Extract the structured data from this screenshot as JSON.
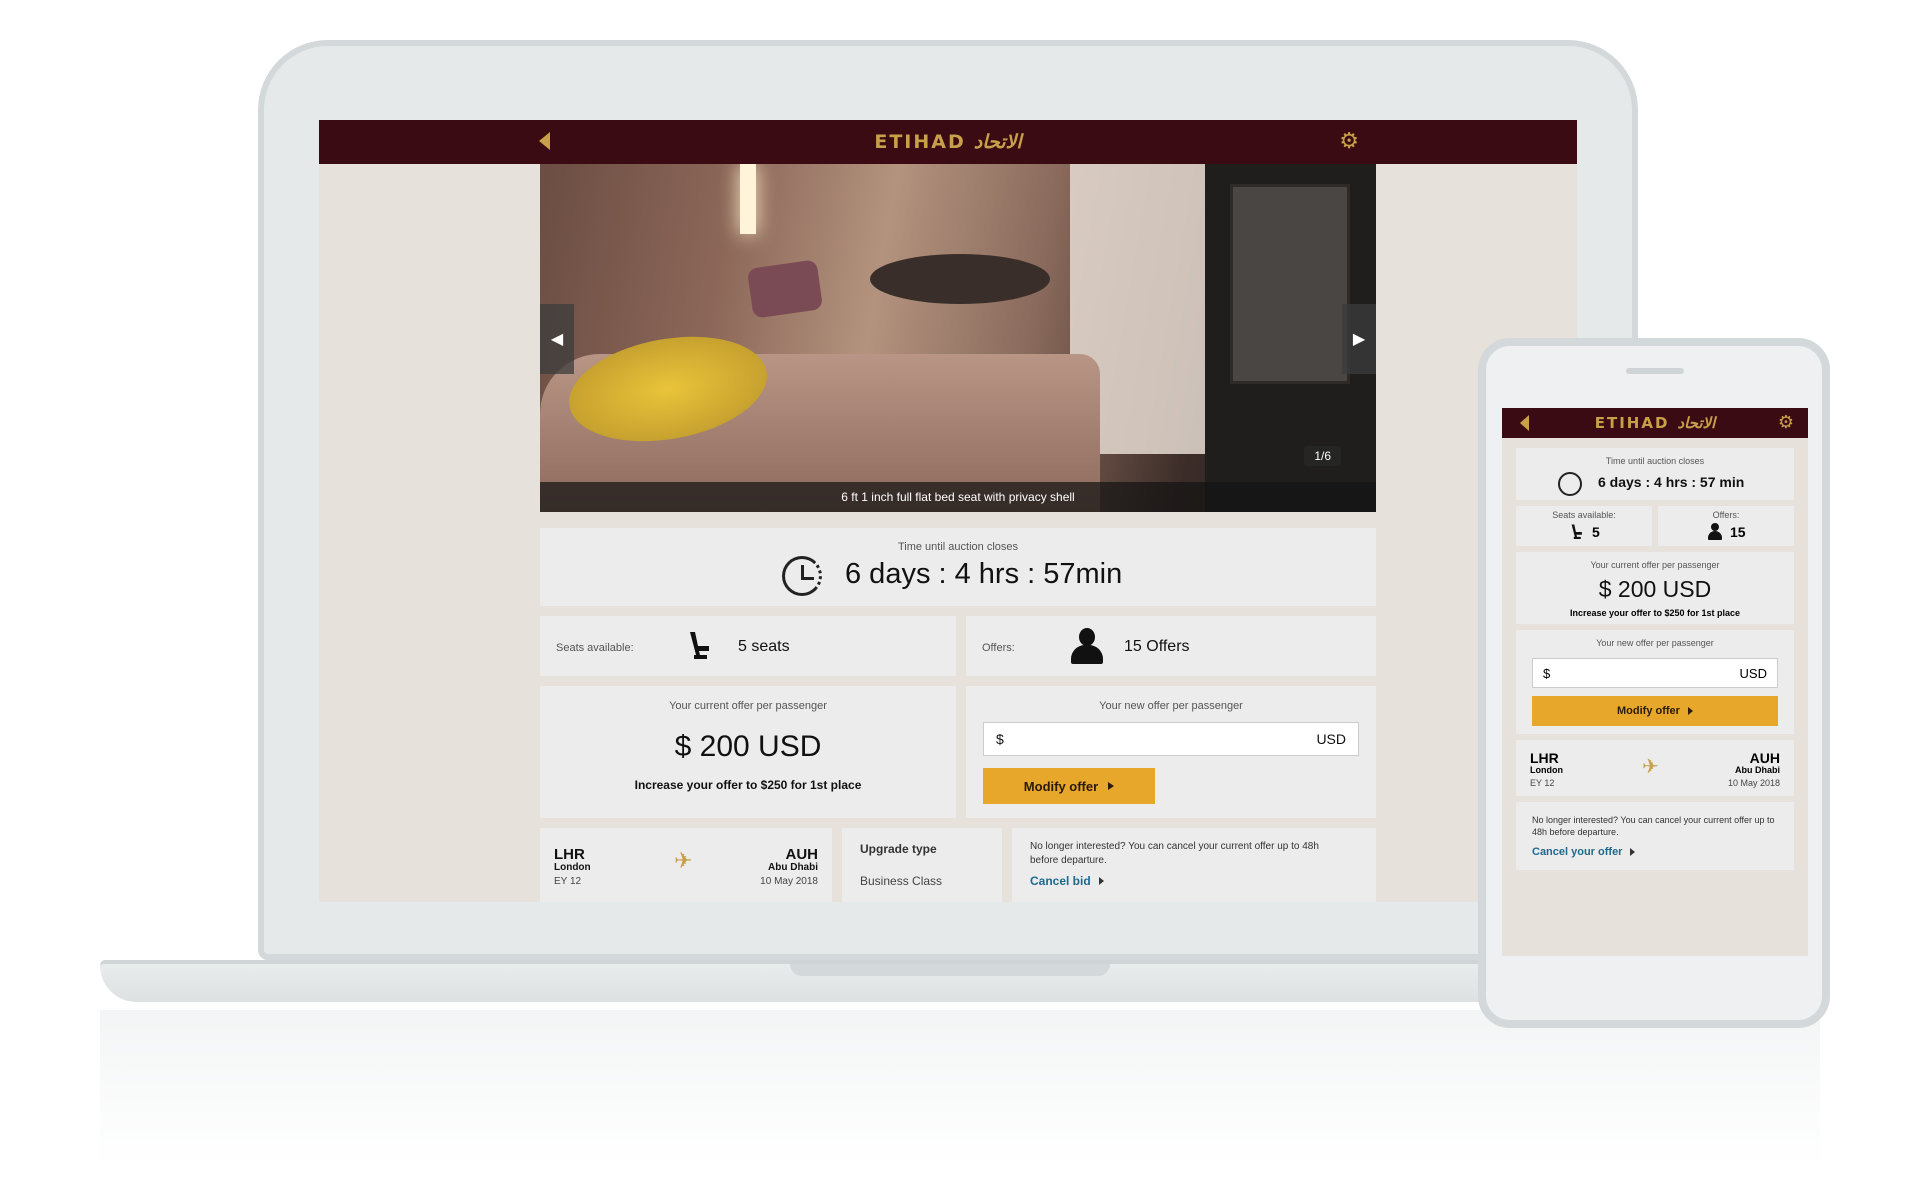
{
  "app": {
    "logo_en": "ETIHAD",
    "logo_ar": "الاتحاد"
  },
  "colors": {
    "topbar": "#3b0b14",
    "accent_gold": "#c9a04a",
    "button": "#e6a72b",
    "link": "#1e6a8d"
  },
  "icons": {
    "back": "chevron-left-icon",
    "settings": "gear-icon",
    "clock": "clock-icon",
    "seat": "seat-icon",
    "user": "user-icon",
    "plane": "plane-icon"
  },
  "gallery": {
    "counter": "1/6",
    "caption": "6 ft 1 inch full flat bed seat with privacy shell"
  },
  "auction": {
    "label": "Time until auction closes",
    "time_desktop": "6 days : 4 hrs : 57min",
    "time_mobile": "6 days : 4 hrs : 57 min"
  },
  "seats": {
    "label": "Seats available:",
    "value_desktop": "5 seats",
    "value_mobile": "5"
  },
  "offers": {
    "label": "Offers:",
    "value_desktop": "15 Offers",
    "value_mobile": "15"
  },
  "current_offer": {
    "label": "Your current offer per passenger",
    "amount": "$ 200 USD",
    "hint": "Increase your offer to $250 for 1st place"
  },
  "new_offer": {
    "label": "Your new offer per passenger",
    "currency_symbol": "$",
    "currency": "USD",
    "button": "Modify offer"
  },
  "flight": {
    "from_code": "LHR",
    "from_city": "London",
    "flight_no": "EY 12",
    "to_code": "AUH",
    "to_city": "Abu Dhabi",
    "date": "10 May 2018"
  },
  "upgrade": {
    "label": "Upgrade type",
    "value": "Business Class"
  },
  "cancel": {
    "text": "No longer interested? You can cancel your current offer up to 48h before departure.",
    "link_desktop": "Cancel bid",
    "link_mobile": "Cancel your offer"
  }
}
